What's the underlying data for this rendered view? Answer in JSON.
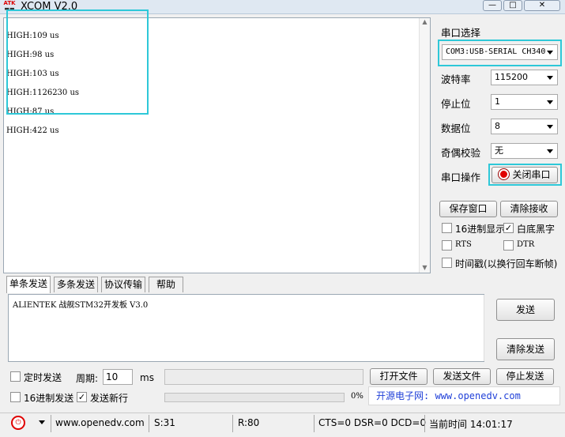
{
  "window": {
    "title": "XCOM V2.0",
    "logo_text": "ATK"
  },
  "receive": {
    "lines": [
      "HIGH:109 us",
      "HIGH:98 us",
      "HIGH:103 us",
      "HIGH:1126230 us",
      "HIGH:87 us",
      "HIGH:422 us"
    ]
  },
  "serial": {
    "port_label": "串口选择",
    "port_value": "COM3:USB-SERIAL CH340",
    "baud_label": "波特率",
    "baud_value": "115200",
    "stop_label": "停止位",
    "stop_value": "1",
    "data_label": "数据位",
    "data_value": "8",
    "parity_label": "奇偶校验",
    "parity_value": "无",
    "op_label": "串口操作",
    "close_label": "关闭串口",
    "save_label": "保存窗口",
    "clear_recv_label": "清除接收",
    "hex_display_label": "16进制显示",
    "white_bg_label": "白底黑字",
    "white_bg_checked": true,
    "rts_label": "RTS",
    "dtr_label": "DTR",
    "timestamp_label": "时间戳(以换行回车断帧)"
  },
  "tabs": [
    "单条发送",
    "多条发送",
    "协议传输",
    "帮助"
  ],
  "send": {
    "text": "ALIENTEK 战舰STM32开发板 V3.0",
    "send_label": "发送",
    "clear_send_label": "清除发送",
    "timed_label": "定时发送",
    "period_label": "周期:",
    "period_value": "10",
    "period_unit": "ms",
    "open_file_label": "打开文件",
    "send_file_label": "发送文件",
    "stop_send_label": "停止发送",
    "hex_send_label": "16进制发送",
    "newline_label": "发送新行",
    "newline_checked": true,
    "progress_text": "0%",
    "progress": 0,
    "brand_text": "开源电子网: www.openedv.com"
  },
  "status": {
    "url": "www.openedv.com",
    "sent": "S:31",
    "received": "R:80",
    "lines": "CTS=0 DSR=0 DCD=0",
    "time": "当前时间 14:01:17"
  },
  "colors": {
    "highlight": "#2ec8d8",
    "brand": "#1f3fd8",
    "indicator": "#e00000"
  }
}
